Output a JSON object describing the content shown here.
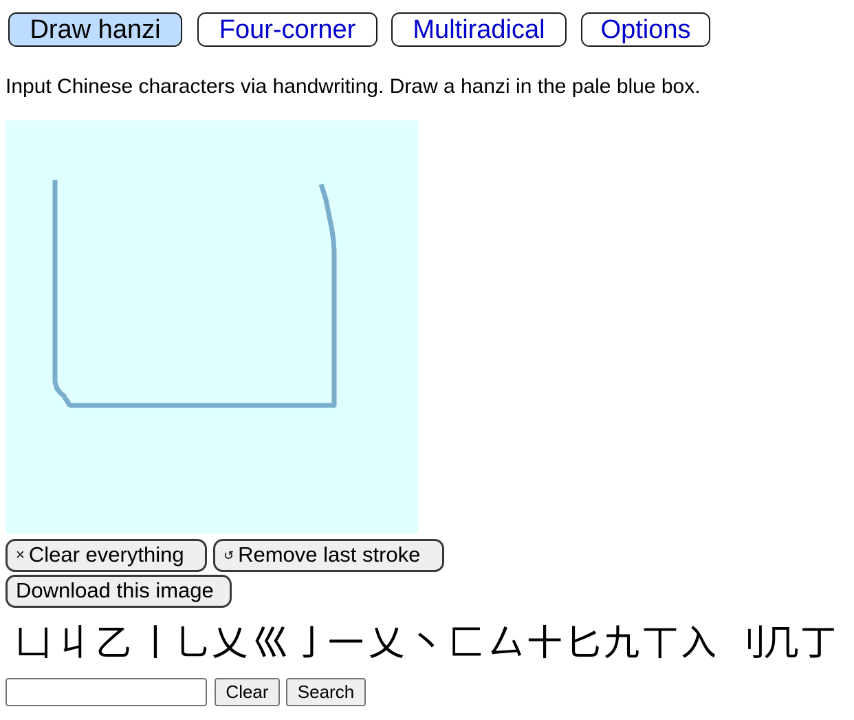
{
  "tabs": [
    {
      "label": "Draw hanzi",
      "active": true
    },
    {
      "label": "Four-corner",
      "active": false
    },
    {
      "label": "Multiradical",
      "active": false
    },
    {
      "label": "Options",
      "active": false
    }
  ],
  "intro_text": "Input Chinese characters via handwriting. Draw a hanzi in the pale blue box.",
  "canvas": {
    "background_color": "#e0ffff",
    "stroke_color": "#7aaccc"
  },
  "actions": {
    "clear_everything_icon": "×",
    "clear_everything_label": "Clear everything",
    "remove_stroke_icon": "↺",
    "remove_stroke_label": "Remove last stroke",
    "download_label": "Download this image"
  },
  "candidates": [
    "凵",
    "丩",
    "乙",
    "丨",
    "乚",
    "乂",
    "巛",
    "亅",
    "一",
    "乂",
    "丶",
    "匚",
    "厶",
    "十",
    "匕",
    "九",
    "丅",
    "入",
    "刂",
    "几",
    "丁"
  ],
  "search": {
    "value": "",
    "clear_label": "Clear",
    "search_label": "Search"
  },
  "colors": {
    "tab_active_bg": "#bddcff",
    "tab_link": "#0000cc"
  }
}
